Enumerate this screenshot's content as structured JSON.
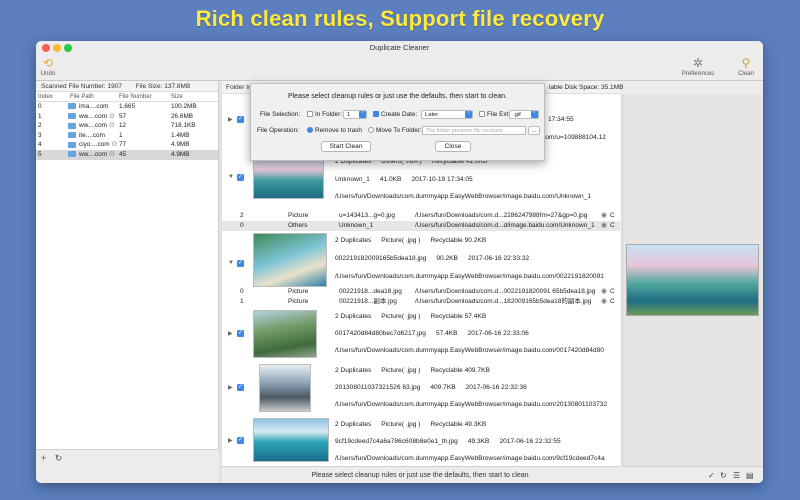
{
  "banner": "Rich clean rules, Support file recovery",
  "window": {
    "title": "Duplicate Cleaner"
  },
  "toolbar": {
    "undo": "Undo",
    "preferences": "Preferences",
    "clean": "Clean"
  },
  "summary": {
    "scanned": "Scanned File Number: 1907",
    "size": "File Size: 137.8MB",
    "disk_space": "lable Disk Space: 35.1MB"
  },
  "file_table": {
    "headers": {
      "index": "Index",
      "path": "File Path",
      "number": "File Number",
      "size": "Size"
    },
    "rows": [
      {
        "index": "0",
        "path": "ima....com",
        "number": "1,665",
        "size": "100.2MB"
      },
      {
        "index": "1",
        "path": "ww....com",
        "number": "57",
        "size": "26.6MB"
      },
      {
        "index": "2",
        "path": "ww....com",
        "number": "12",
        "size": "716.1KB"
      },
      {
        "index": "3",
        "path": "ite....com",
        "number": "1",
        "size": "1.4MB"
      },
      {
        "index": "4",
        "path": "ciyo....com",
        "number": "77",
        "size": "4.9MB"
      },
      {
        "index": "5",
        "path": "ww....com",
        "number": "45",
        "size": "4.9MB"
      }
    ]
  },
  "center_header": "Folder In",
  "groups": [
    {
      "line1": "",
      "line2": "17:34:55",
      "line3": "/Users/fun/Downloads/com.dummyapp.EasyWebBrowser/image.baidu.com/u=109888104,12"
    },
    {
      "dup": "2 Duplicates",
      "type": "Others( .N/A )",
      "recycl": "Recyclable 41.0KB",
      "name": "Unknown_1",
      "size": "41.0KB",
      "date": "2017-10-19 17:34:05",
      "path": "/Users/fun/Downloads/com.dummyapp.EasyWebBrowser/image.baidu.com/Unknown_1"
    },
    {
      "dup": "2 Duplicates",
      "type": "Picture( .jpg )",
      "recycl": "Recyclable 90.2KB",
      "name": "002219182009165b5dea18.jpg",
      "size": "90.2KB",
      "date": "2017-06-16 22:33:32",
      "path": "/Users/fun/Downloads/com.dummyapp.EasyWebBrowser/image.baidu.com/0022191820091"
    },
    {
      "dup": "2 Duplicates",
      "type": "Picture( .jpg )",
      "recycl": "Recyclable 57.4KB",
      "name": "0017420d84d80bec7d6217.jpg",
      "size": "57.4KB",
      "date": "2017-06-16 22:33:06",
      "path": "/Users/fun/Downloads/com.dummyapp.EasyWebBrowser/image.baidu.com/0017420d84d80"
    },
    {
      "dup": "2 Duplicates",
      "type": "Picture( .jpg )",
      "recycl": "Recyclable 409.7KB",
      "name": "201308011037321526 63.jpg",
      "size": "409.7KB",
      "date": "2017-06-16 22:32:36",
      "path": "/Users/fun/Downloads/com.dummyapp.EasyWebBrowser/image.baidu.com/20130801103732"
    },
    {
      "dup": "2 Duplicates",
      "type": "Picture( .jpg )",
      "recycl": "Recyclable 49.3KB",
      "name": "9cf19cdeed7c4a6a786c608b8e0e1_th.jpg",
      "size": "49.3KB",
      "date": "2017-06-16 22:32:55",
      "path": "/Users/fun/Downloads/com.dummyapp.EasyWebBrowser/image.baidu.com/9cf19cdeed7c4a"
    }
  ],
  "sub_rows_a": [
    {
      "idx": "2",
      "type": "Picture",
      "name": "u=143413...g=0.jpg",
      "path": "/Users/fun/Downloads/com.d...2286247988fm=27&gp=0.jpg",
      "tail": "C"
    },
    {
      "idx": "0",
      "type": "Others",
      "name": "Unknown_1",
      "path": "/Users/fun/Downloads/com.d...d/image.baidu.com/Unknown_1",
      "tail": "C"
    }
  ],
  "sub_rows_b": [
    {
      "idx": "0",
      "type": "Picture",
      "name": "00221918...dea18.jpg",
      "path": "/Users/fun/Downloads/com.d...0022191820091 65b5dea18.jpg",
      "tail": "C"
    },
    {
      "idx": "1",
      "type": "Picture",
      "name": "00221918...副本.jpg",
      "path": "/Users/fun/Downloads/com.d...182009165b5dea18的副本.jpg",
      "tail": "C"
    }
  ],
  "sheet": {
    "prompt": "Please select cleanup rules or just use the defaults, then start to clean.",
    "file_selection": "File Selection:",
    "in_folder": "In Folder:",
    "in_folder_value": "1",
    "create_date": "Create Date:",
    "create_date_value": "Later",
    "file_ext": "File Ext:",
    "file_ext_value": ".gif",
    "file_operation": "File Operation:",
    "remove_to_trash": "Remove to trash",
    "move_to_folder": "Move To Folder:",
    "folder_placeholder": "The folder prevents file recovery",
    "folder_browse": "...",
    "start_clean": "Start Clean",
    "close": "Close"
  },
  "status_text": "Please select cleanup rules or just use the defaults, then start to clean.",
  "footer": {
    "add": "+",
    "refresh": "↻",
    "check": "✓",
    "refresh2": "↻",
    "list": "☰",
    "grid": "▤"
  }
}
